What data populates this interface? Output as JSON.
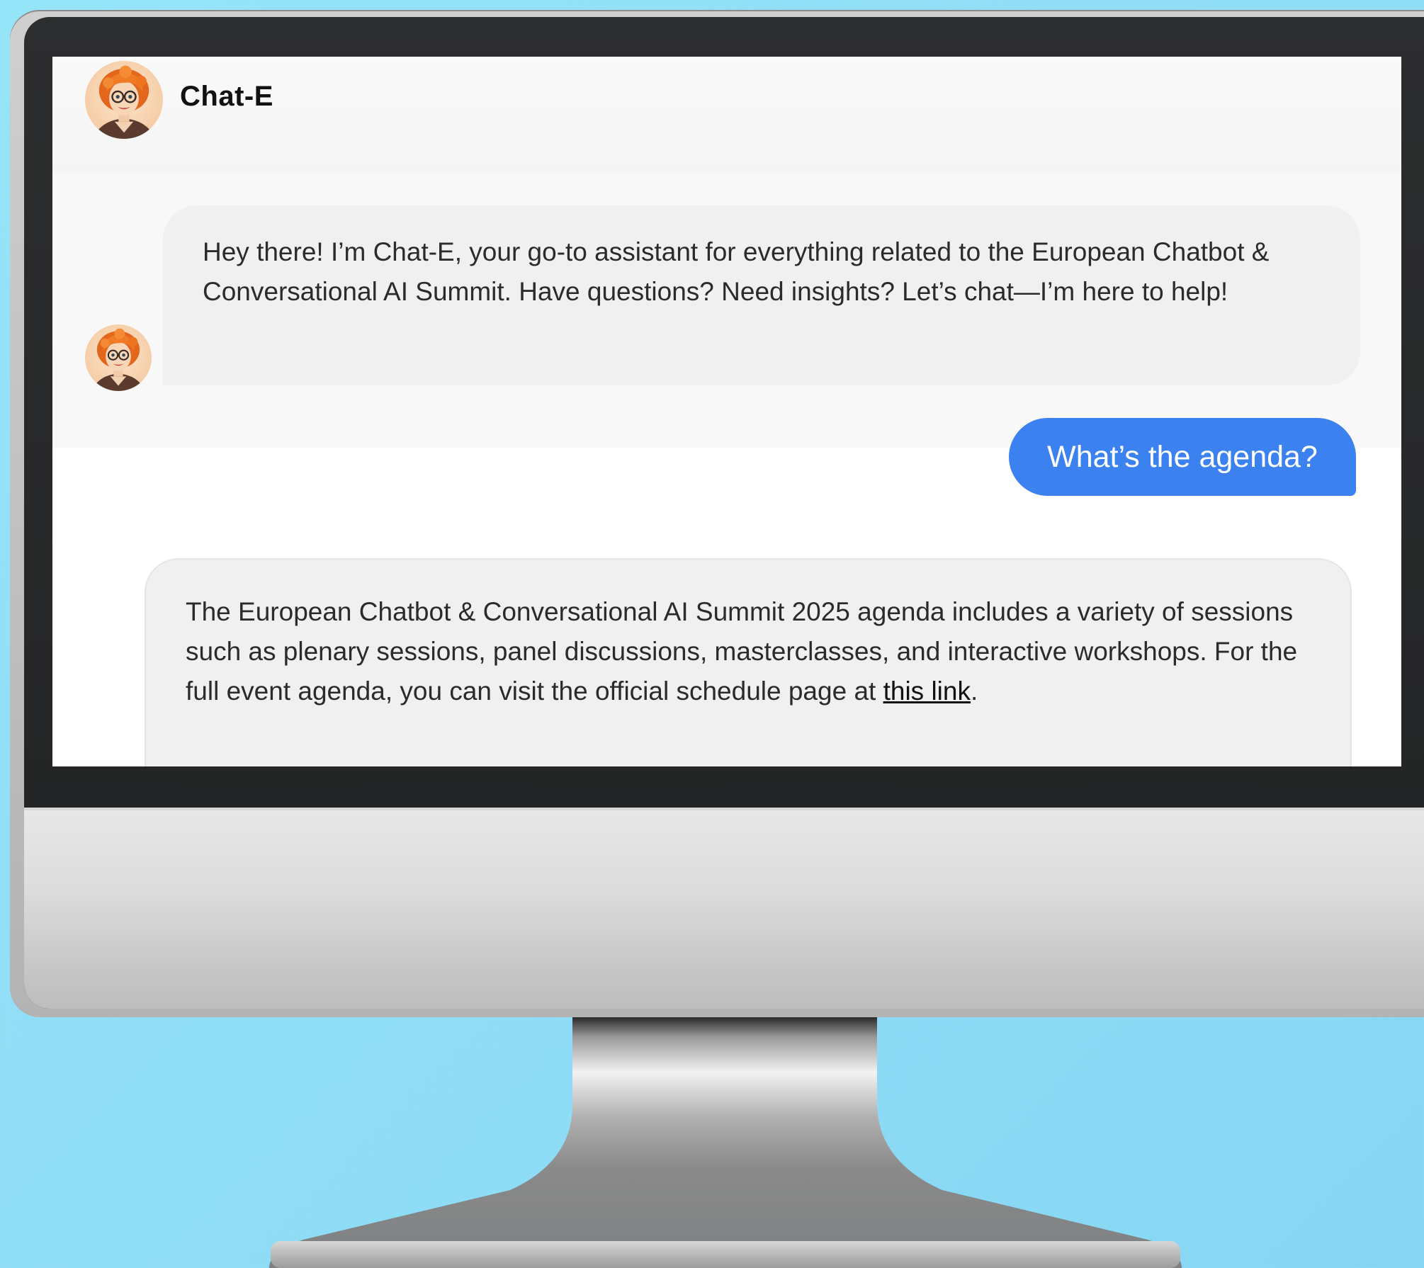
{
  "header": {
    "title": "Chat-E",
    "avatar_icon": "woman-avatar-icon"
  },
  "messages": [
    {
      "sender": "bot",
      "text": "Hey there! I’m Chat-E, your go-to assistant for everything related to the European Chatbot & Conversational AI Summit. Have questions? Need insights? Let’s chat—I’m here to help!"
    },
    {
      "sender": "user",
      "text": "What’s the agenda?"
    },
    {
      "sender": "bot",
      "text_before_link": "The European Chatbot & Conversational AI Summit 2025 agenda includes a variety of sessions such as plenary sessions, panel discussions, masterclasses, and interactive workshops. For the full event agenda, you can visit the official schedule page at ",
      "link_text": "this link",
      "text_after_link": "."
    }
  ],
  "colors": {
    "background": "#8fdcf6",
    "user_bubble": "#3b82f0",
    "bot_bubble": "#f0f0f0",
    "bezel": "#2c2d2e"
  }
}
